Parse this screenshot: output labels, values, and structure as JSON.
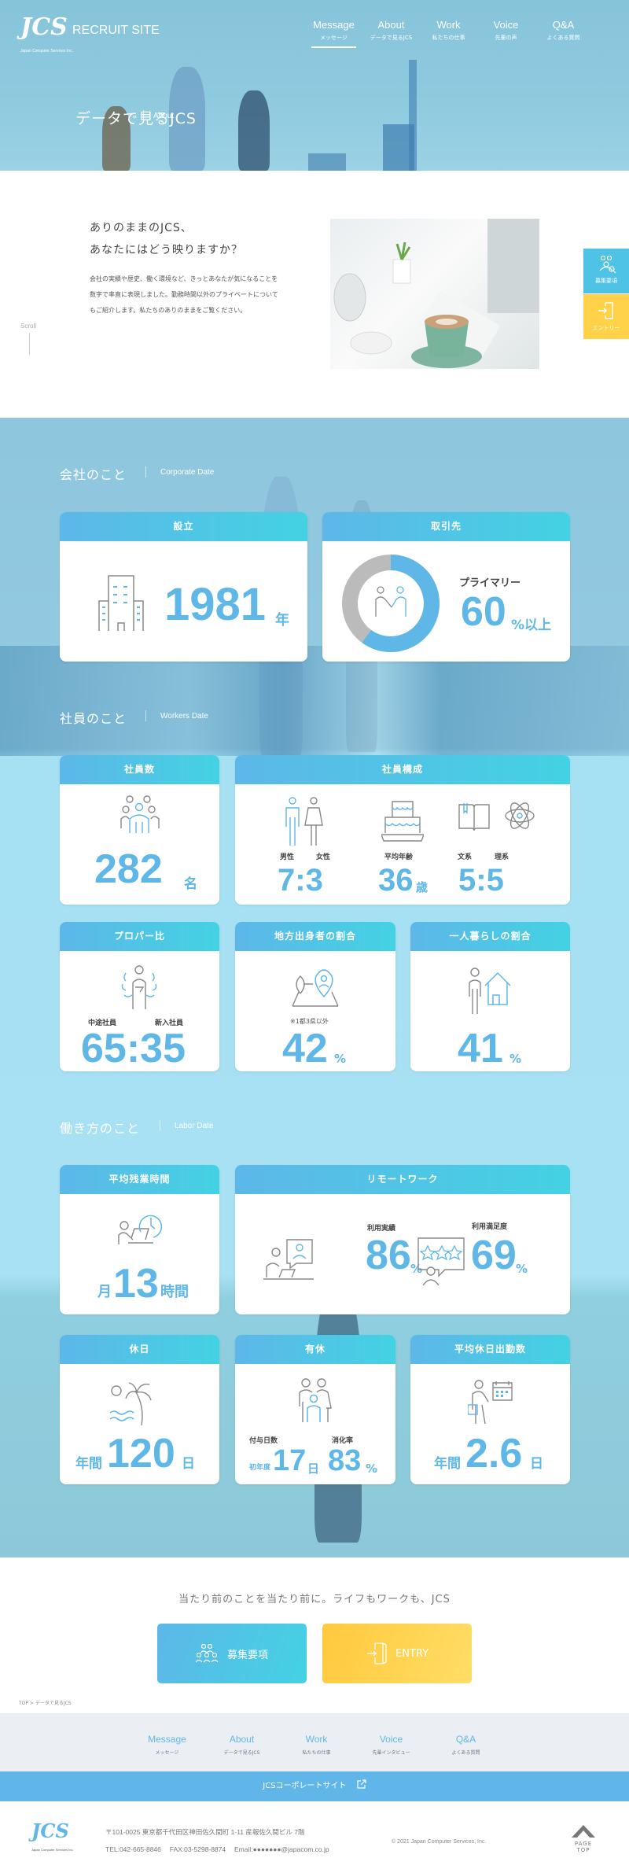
{
  "header": {
    "logo": "JCS",
    "logo_sub": "Japan Computer Services Inc.",
    "site": "RECRUIT SITE",
    "nav": [
      {
        "en": "Message",
        "jp": "メッセージ"
      },
      {
        "en": "About",
        "jp": "データで見るJCS"
      },
      {
        "en": "Work",
        "jp": "私たちの仕事"
      },
      {
        "en": "Voice",
        "jp": "先輩の声"
      },
      {
        "en": "Q&A",
        "jp": "よくある質問"
      }
    ]
  },
  "hero": {
    "title": "データで見るJCS",
    "sub": "About"
  },
  "intro": {
    "heading1": "ありのままのJCS、",
    "heading2": "あなたにはどう映りますか？",
    "body": "会社の実績や歴史、働く環境など、きっとあなたが気になることを数字で率直に表現しました。勤務時間以外のプライベートについてもご紹介します。私たちのありのままをご覧ください。",
    "scroll": "Scroll"
  },
  "side": {
    "recruit": "募集要項",
    "entry": "エントリー"
  },
  "corporate": {
    "title": "会社のこと",
    "sub": "Corporate Date",
    "founded": {
      "head": "設立",
      "value": "1981",
      "unit": "年"
    },
    "clients": {
      "head": "取引先",
      "label": "プライマリー",
      "value": "60",
      "unit": "%以上",
      "percent": 60
    }
  },
  "workers": {
    "title": "社員のこと",
    "sub": "Workers Date",
    "count": {
      "head": "社員数",
      "value": "282",
      "unit": "名"
    },
    "composition": {
      "head": "社員構成",
      "male": "男性",
      "female": "女性",
      "gender": "7:3",
      "age_label": "平均年齢",
      "age": "36",
      "age_unit": "歳",
      "arts": "文系",
      "science": "理系",
      "major": "5:5"
    },
    "proper": {
      "head": "プロパー比",
      "mid": "中途社員",
      "new": "新入社員",
      "value": "65:35"
    },
    "local": {
      "head": "地方出身者の割合",
      "note": "※1都3県以外",
      "value": "42",
      "unit": "%"
    },
    "alone": {
      "head": "一人暮らしの割合",
      "value": "41",
      "unit": "%"
    }
  },
  "labor": {
    "title": "働き方のこと",
    "sub": "Labor Date",
    "overtime": {
      "head": "平均残業時間",
      "pre": "月",
      "value": "13",
      "unit": "時間"
    },
    "remote": {
      "head": "リモートワーク",
      "use_label": "利用実績",
      "use": "86",
      "sat_label": "利用満足度",
      "sat": "69",
      "unit": "%"
    },
    "holiday": {
      "head": "休日",
      "pre": "年間",
      "value": "120",
      "unit": "日"
    },
    "paid": {
      "head": "有休",
      "grant_label": "付与日数",
      "pre": "初年度",
      "grant": "17",
      "grant_unit": "日",
      "rate_label": "消化率",
      "rate": "83",
      "rate_unit": "%"
    },
    "holiday_work": {
      "head": "平均休日出勤数",
      "pre": "年間",
      "value": "2.6",
      "unit": "日"
    }
  },
  "cta": {
    "tagline": "当たり前のことを当たり前に。ライフもワークも、JCS",
    "recruit": "募集要項",
    "entry": "ENTRY",
    "breadcrumb": "TOP > データで見るJCS"
  },
  "footer": {
    "nav": [
      {
        "en": "Message",
        "jp": "メッセージ"
      },
      {
        "en": "About",
        "jp": "データで見るJCS"
      },
      {
        "en": "Work",
        "jp": "私たちの仕事"
      },
      {
        "en": "Voice",
        "jp": "先輩インタビュー"
      },
      {
        "en": "Q&A",
        "jp": "よくある質問"
      }
    ],
    "corporate_link": "JCSコーポレートサイト",
    "logo": "JCS",
    "logo_sub": "Japan Computer Services Inc.",
    "address": "〒101-0025 東京都千代田区神田佐久間町 1-11 産報佐久間ビル 7階",
    "contact": "TEL:042-665-8846　 FAX:03-5298-8874　 Email:●●●●●●●@japacom.co.jp",
    "copyright": "© 2021 Japan Computer Services, Inc.",
    "pagetop": "PAGE TOP"
  },
  "colors": {
    "accent": "#5fb7e8",
    "cyan": "#43d2e3",
    "yellow": "#ffd24a",
    "gray": "#bbbbbb"
  }
}
